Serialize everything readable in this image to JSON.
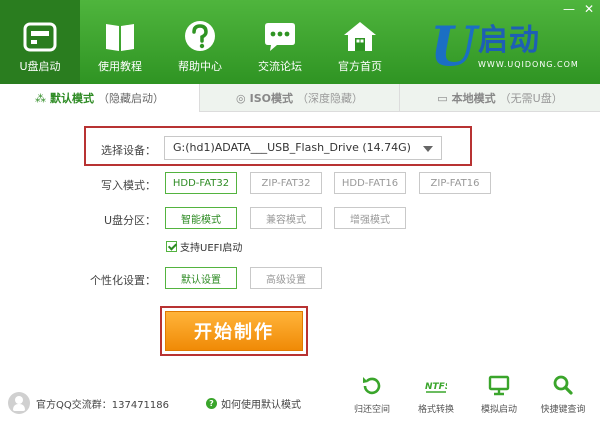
{
  "window_controls": {
    "minimize": "—",
    "close": "✕"
  },
  "nav": [
    {
      "label": "U盘启动",
      "icon": "usb-drive-icon"
    },
    {
      "label": "使用教程",
      "icon": "book-icon"
    },
    {
      "label": "帮助中心",
      "icon": "help-icon"
    },
    {
      "label": "交流论坛",
      "icon": "chat-icon"
    },
    {
      "label": "官方首页",
      "icon": "home-icon"
    }
  ],
  "brand": {
    "letter": "U",
    "name": "启动",
    "url": "WWW.UQIDONG.COM"
  },
  "tabs": [
    {
      "icon": "⁂",
      "title": "默认模式",
      "subtitle": "（隐藏启动）"
    },
    {
      "icon": "◎",
      "title": "ISO模式",
      "subtitle": "（深度隐藏）"
    },
    {
      "icon": "▭",
      "title": "本地模式",
      "subtitle": "（无需U盘）"
    }
  ],
  "form": {
    "device_label": "选择设备：",
    "device_value": "G:(hd1)ADATA___USB_Flash_Drive (14.74G)",
    "write_label": "写入模式：",
    "write_options": [
      "HDD-FAT32",
      "ZIP-FAT32",
      "HDD-FAT16",
      "ZIP-FAT16"
    ],
    "partition_label": "U盘分区：",
    "partition_options": [
      "智能模式",
      "兼容模式",
      "增强模式"
    ],
    "uefi_label": "支持UEFI启动",
    "personal_label": "个性化设置：",
    "personal_options": [
      "默认设置",
      "高级设置"
    ],
    "start_label": "开始制作"
  },
  "footer": {
    "qq_text": "官方QQ交流群：137471186",
    "help_text": "如何使用默认模式",
    "help_icon": "?",
    "tools": [
      {
        "label": "归还空间",
        "icon": "restore-icon"
      },
      {
        "label": "格式转换",
        "icon": "ntfs-icon",
        "glyph": "NTFS"
      },
      {
        "label": "模拟启动",
        "icon": "monitor-icon"
      },
      {
        "label": "快捷键查询",
        "icon": "search-icon"
      }
    ]
  },
  "colors": {
    "header": "#3aa52b",
    "active_nav": "#2a7d1f",
    "accent_green": "#2e8b24",
    "highlight_red": "#b83232",
    "start_orange": "#f59a12"
  }
}
